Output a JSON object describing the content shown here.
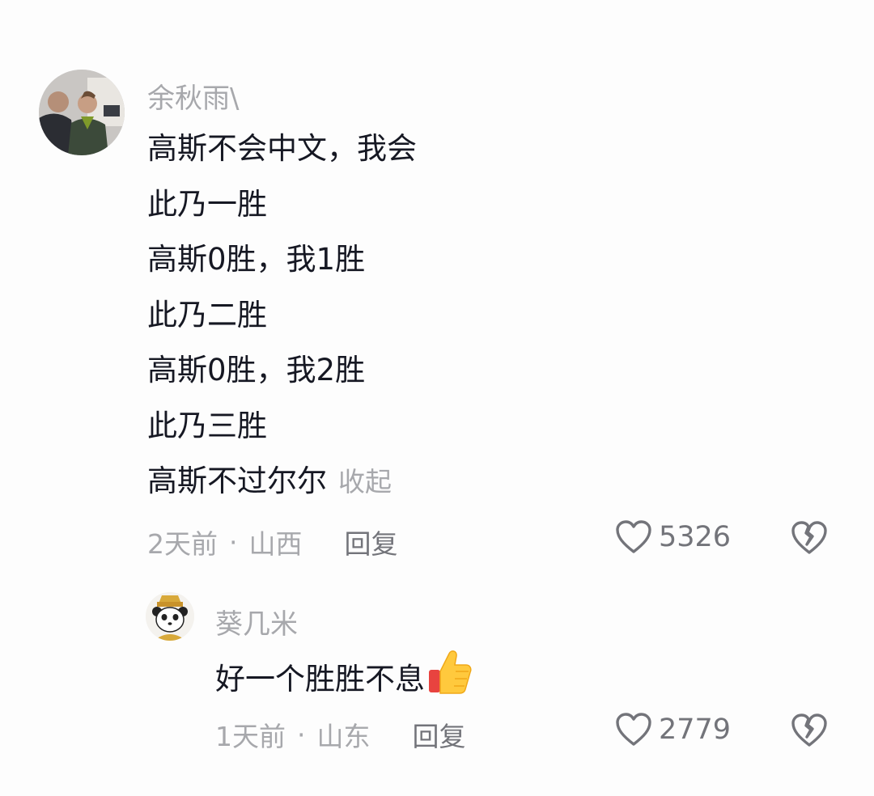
{
  "comments": [
    {
      "username": "余秋雨\\",
      "lines": [
        "高斯不会中文，我会",
        "此乃一胜",
        "高斯0胜，我1胜",
        "此乃二胜",
        "高斯0胜，我2胜",
        "此乃三胜",
        "高斯不过尔尔"
      ],
      "collapse_label": "收起",
      "time": "2天前",
      "separator": "·",
      "location": "山西",
      "reply_label": "回复",
      "like_count": "5326"
    }
  ],
  "replies": [
    {
      "username": "葵几米",
      "text": "好一个胜胜不息",
      "emoji": "thumbs-up-icon",
      "time": "1天前",
      "separator": "·",
      "location": "山东",
      "reply_label": "回复",
      "like_count": "2779"
    }
  ],
  "colors": {
    "text": "#161823",
    "muted": "#a7a8ac",
    "action": "#73747a",
    "background": "#fdfdfd"
  }
}
